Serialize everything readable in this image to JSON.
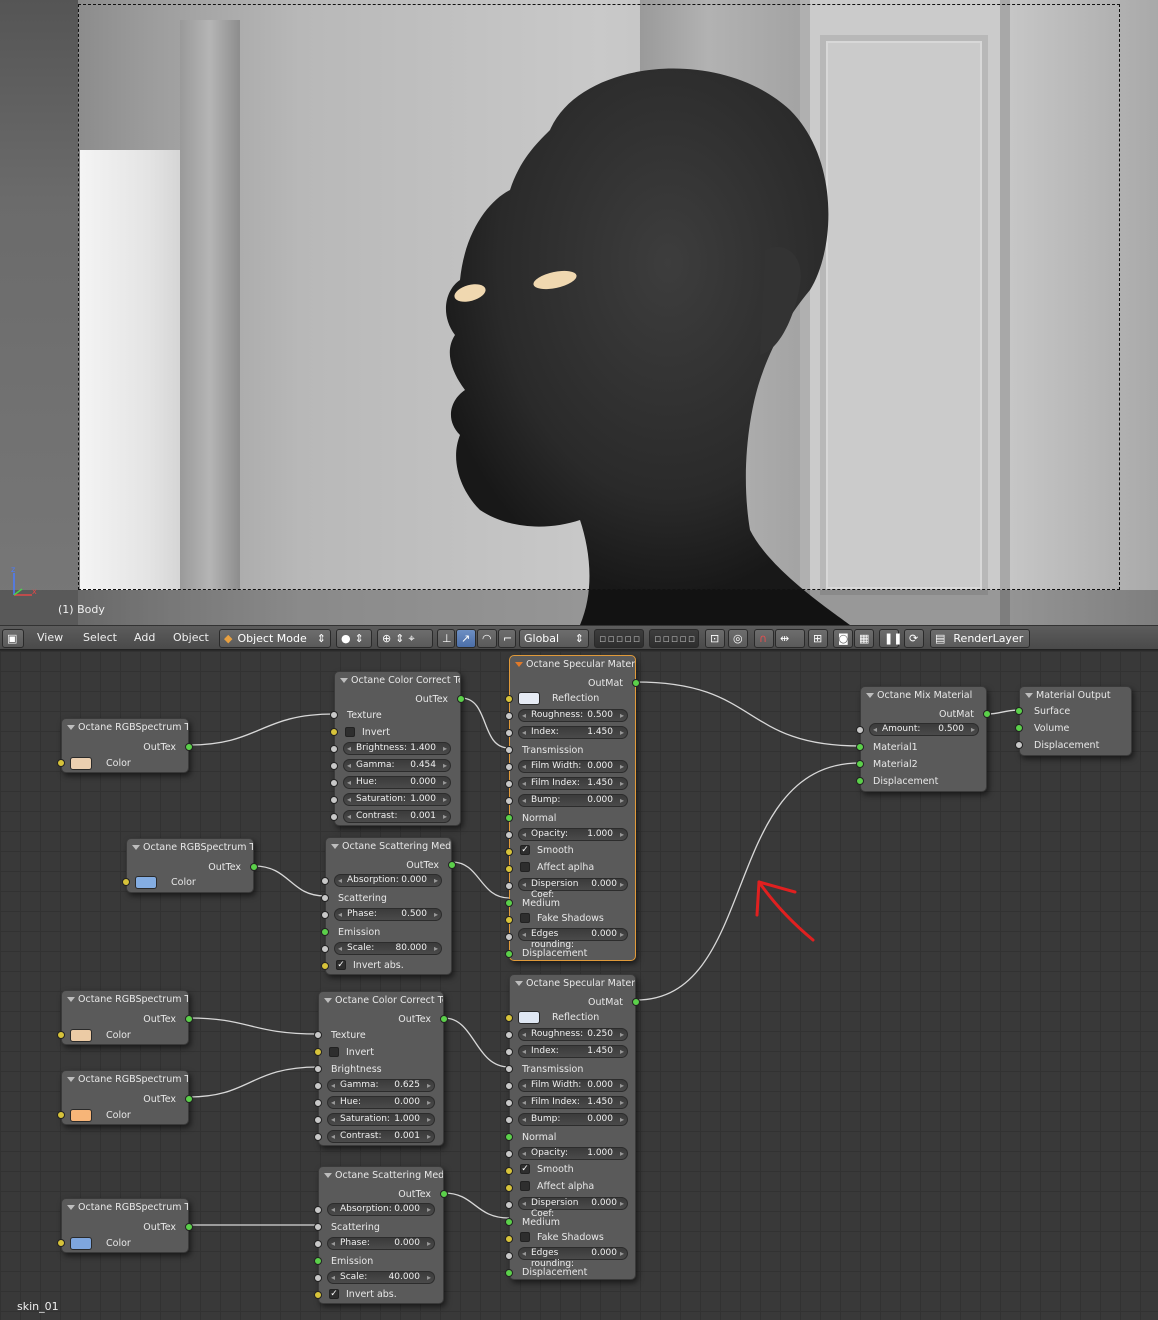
{
  "viewport": {
    "object_label": "(1) Body"
  },
  "header": {
    "menu": [
      "View",
      "Select",
      "Add",
      "Object"
    ],
    "mode": "Object Mode",
    "orientation": "Global",
    "render_layer": "RenderLayer"
  },
  "material_name": "skin_01",
  "nodes": {
    "rgb1": {
      "title": "Octane RGBSpectrum T...",
      "out": "OutTex",
      "color_label": "Color",
      "swatch": "#ebcfb0"
    },
    "cc1": {
      "title": "Octane Color Correct Tex",
      "out": "OutTex",
      "texture": "Texture",
      "invert": "Invert",
      "fields": [
        [
          "Brightness:",
          "1.400"
        ],
        [
          "Gamma:",
          "0.454"
        ],
        [
          "Hue:",
          "0.000"
        ],
        [
          "Saturation:",
          "1.000"
        ],
        [
          "Contrast:",
          "0.001"
        ]
      ]
    },
    "rgb2": {
      "title": "Octane RGBSpectrum Te",
      "out": "OutTex",
      "color_label": "Color",
      "swatch": "#84ade2"
    },
    "sc1": {
      "title": "Octane Scattering Medi...",
      "out": "OutTex",
      "absorption": [
        "Absorption:",
        "0.000"
      ],
      "scattering": "Scattering",
      "phase": [
        "Phase:",
        "0.500"
      ],
      "emission": "Emission",
      "scale": [
        "Scale:",
        "80.000"
      ],
      "invert_abs": "Invert abs."
    },
    "spec1": {
      "title": "Octane Specular Material",
      "out": "OutMat",
      "reflection": "Reflection",
      "roughness": [
        "Roughness:",
        "0.500"
      ],
      "index": [
        "Index:",
        "1.450"
      ],
      "transmission": "Transmission",
      "film_width": [
        "Film Width:",
        "0.000"
      ],
      "film_index": [
        "Film Index:",
        "1.450"
      ],
      "bump": [
        "Bump:",
        "0.000"
      ],
      "normal": "Normal",
      "opacity": [
        "Opacity:",
        "1.000"
      ],
      "smooth": "Smooth",
      "affect": "Affect aplha",
      "dispersion": [
        "Dispersion Coef:",
        "0.000"
      ],
      "medium": "Medium",
      "fake": "Fake Shadows",
      "edges": [
        "Edges rounding:",
        "0.000"
      ],
      "displacement": "Displacement"
    },
    "rgb3": {
      "title": "Octane RGBSpectrum T...",
      "out": "OutTex",
      "color_label": "Color",
      "swatch": "#eccba5"
    },
    "cc2": {
      "title": "Octane Color Correct Tex",
      "out": "OutTex",
      "texture": "Texture",
      "invert": "Invert",
      "brightness": "Brightness",
      "fields": [
        [
          "Gamma:",
          "0.625"
        ],
        [
          "Hue:",
          "0.000"
        ],
        [
          "Saturation:",
          "1.000"
        ],
        [
          "Contrast:",
          "0.001"
        ]
      ]
    },
    "rgb4": {
      "title": "Octane RGBSpectrum T...",
      "out": "OutTex",
      "color_label": "Color",
      "swatch": "#f7b578"
    },
    "spec2": {
      "title": "Octane Specular Material",
      "out": "OutMat",
      "reflection": "Reflection",
      "roughness": [
        "Roughness:",
        "0.250"
      ],
      "index": [
        "Index:",
        "1.450"
      ],
      "transmission": "Transmission",
      "film_width": [
        "Film Width:",
        "0.000"
      ],
      "film_index": [
        "Film Index:",
        "1.450"
      ],
      "bump": [
        "Bump:",
        "0.000"
      ],
      "normal": "Normal",
      "opacity": [
        "Opacity:",
        "1.000"
      ],
      "smooth": "Smooth",
      "affect": "Affect alpha",
      "dispersion": [
        "Dispersion Coef:",
        "0.000"
      ],
      "medium": "Medium",
      "fake": "Fake Shadows",
      "edges": [
        "Edges rounding:",
        "0.000"
      ],
      "displacement": "Displacement"
    },
    "sc2": {
      "title": "Octane Scattering Medi...",
      "out": "OutTex",
      "absorption": [
        "Absorption:",
        "0.000"
      ],
      "scattering": "Scattering",
      "phase": [
        "Phase:",
        "0.000"
      ],
      "emission": "Emission",
      "scale": [
        "Scale:",
        "40.000"
      ],
      "invert_abs": "Invert abs."
    },
    "rgb5": {
      "title": "Octane RGBSpectrum T...",
      "out": "OutTex",
      "color_label": "Color",
      "swatch": "#7ea6de"
    },
    "mix": {
      "title": "Octane Mix Material",
      "out": "OutMat",
      "amount": [
        "Amount:",
        "0.500"
      ],
      "m1": "Material1",
      "m2": "Material2",
      "disp": "Displacement"
    },
    "output": {
      "title": "Material Output",
      "surface": "Surface",
      "volume": "Volume",
      "disp": "Displacement"
    }
  }
}
